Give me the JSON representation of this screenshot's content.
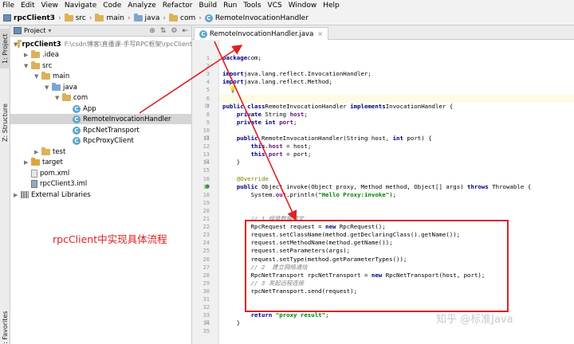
{
  "menu": [
    "File",
    "Edit",
    "View",
    "Navigate",
    "Code",
    "Analyze",
    "Refactor",
    "Build",
    "Run",
    "Tools",
    "VCS",
    "Window",
    "Help"
  ],
  "breadcrumb": [
    "rpcClient3",
    "src",
    "main",
    "java",
    "com",
    "RemoteInvocationHandler"
  ],
  "tool_tabs": {
    "project": "1: Project",
    "structure": "Z: Structure",
    "favorites": "2: Favorites"
  },
  "project_panel": {
    "title": "Project",
    "root_path": "F:\\csdn博客\\直播课-手写RPC框架\\rpcClient",
    "tree": [
      {
        "label": "rpcClient3",
        "kind": "project",
        "arrow": "▼",
        "indent": 0
      },
      {
        "label": ".idea",
        "kind": "folder",
        "arrow": "▶",
        "indent": 1
      },
      {
        "label": "src",
        "kind": "folder",
        "arrow": "▼",
        "indent": 1
      },
      {
        "label": "main",
        "kind": "folder",
        "arrow": "▼",
        "indent": 2
      },
      {
        "label": "java",
        "kind": "folder-blue",
        "arrow": "▼",
        "indent": 3
      },
      {
        "label": "com",
        "kind": "folder",
        "arrow": "▼",
        "indent": 4
      },
      {
        "label": "App",
        "kind": "class",
        "arrow": "",
        "indent": 5
      },
      {
        "label": "RemoteInvocationHandler",
        "kind": "class",
        "arrow": "",
        "indent": 5,
        "selected": true
      },
      {
        "label": "RpcNetTransport",
        "kind": "class",
        "arrow": "",
        "indent": 5
      },
      {
        "label": "RpcProxyClient",
        "kind": "class",
        "arrow": "",
        "indent": 5
      },
      {
        "label": "test",
        "kind": "folder",
        "arrow": "▶",
        "indent": 2
      },
      {
        "label": "target",
        "kind": "folder-orange",
        "arrow": "▶",
        "indent": 1
      },
      {
        "label": "pom.xml",
        "kind": "file",
        "arrow": "",
        "indent": 1
      },
      {
        "label": "rpcClient3.iml",
        "kind": "iml",
        "arrow": "",
        "indent": 1
      },
      {
        "label": "External Libraries",
        "kind": "lib",
        "arrow": "▶",
        "indent": 0
      }
    ]
  },
  "editor": {
    "tab_label": "RemoteInvocationHandler.java",
    "line_numbers": [
      "1",
      "2",
      "3",
      "4",
      "5",
      "6",
      "7",
      "8",
      "9",
      "10",
      "11",
      "12",
      "13",
      "14",
      "15",
      "16",
      "17",
      "18",
      "19",
      "20",
      "21",
      "22",
      "23",
      "24",
      "25",
      "26",
      "27",
      "28",
      "29",
      "30",
      "31",
      "32",
      "33",
      "34",
      "35"
    ],
    "lines": [
      [
        [
          "kw",
          "package"
        ],
        [
          "",
          "com;"
        ]
      ],
      [],
      [
        [
          "kw",
          "import"
        ],
        [
          "",
          "java.lang.reflect.InvocationHandler;"
        ]
      ],
      [
        [
          "kw",
          "import"
        ],
        [
          "",
          "java.lang.reflect.Method;"
        ]
      ],
      [],
      [],
      [
        [
          "kw",
          "public class"
        ],
        [
          "",
          "RemoteInvocationHandler "
        ],
        [
          "kw",
          "implements"
        ],
        [
          "",
          "InvocationHandler {"
        ]
      ],
      [
        [
          "",
          "    "
        ],
        [
          "kw",
          "private"
        ],
        [
          "",
          " String "
        ],
        [
          "fld",
          "host"
        ],
        [
          "",
          ";"
        ]
      ],
      [
        [
          "",
          "    "
        ],
        [
          "kw",
          "private int"
        ],
        [
          "",
          " "
        ],
        [
          "fld",
          "port"
        ],
        [
          "",
          ";"
        ]
      ],
      [],
      [
        [
          "",
          "    "
        ],
        [
          "kw",
          "public"
        ],
        [
          "",
          " RemoteInvocationHandler(String host, "
        ],
        [
          "kw",
          "int"
        ],
        [
          "",
          " port) {"
        ]
      ],
      [
        [
          "",
          "        "
        ],
        [
          "kw",
          "this"
        ],
        [
          "",
          "."
        ],
        [
          "fld",
          "host"
        ],
        [
          "",
          " = host;"
        ]
      ],
      [
        [
          "",
          "        "
        ],
        [
          "kw",
          "this"
        ],
        [
          "",
          "."
        ],
        [
          "fld",
          "port"
        ],
        [
          "",
          " = port;"
        ]
      ],
      [
        [
          "",
          "    }"
        ]
      ],
      [],
      [
        [
          "",
          "    "
        ],
        [
          "ann",
          "@Override"
        ]
      ],
      [
        [
          "",
          "    "
        ],
        [
          "kw",
          "public"
        ],
        [
          "",
          " Object invoke(Object proxy, Method method, Object[] args) "
        ],
        [
          "kw",
          "throws"
        ],
        [
          "",
          " Throwable {"
        ]
      ],
      [
        [
          "",
          "        System."
        ],
        [
          "fld",
          "out"
        ],
        [
          "",
          ".println("
        ],
        [
          "str",
          "\"Hello Proxy:invoke\""
        ],
        [
          "",
          ");"
        ]
      ],
      [],
      [],
      [
        [
          "",
          "        "
        ],
        [
          "cmt",
          "// 1 组装数据报文"
        ]
      ],
      [
        [
          "",
          "        RpcRequest request = "
        ],
        [
          "kw",
          "new"
        ],
        [
          "",
          " RpcRequest();"
        ]
      ],
      [
        [
          "",
          "        request.setClassName(method.getDeclaringClass().getName());"
        ]
      ],
      [
        [
          "",
          "        request.setMethodName(method.getName());"
        ]
      ],
      [
        [
          "",
          "        request.setParameters(args);"
        ]
      ],
      [
        [
          "",
          "        request.setType(method.getParameterTypes());"
        ]
      ],
      [
        [
          "",
          "        "
        ],
        [
          "cmt",
          "// 2  建立网络通信"
        ]
      ],
      [
        [
          "",
          "        RpcNetTransport rpcNetTransport = "
        ],
        [
          "kw",
          "new"
        ],
        [
          "",
          " RpcNetTransport(host, port);"
        ]
      ],
      [
        [
          "",
          "        "
        ],
        [
          "cmt",
          "// 3 发起远程连接"
        ]
      ],
      [
        [
          "",
          "        rpcNetTransport.send(request);"
        ]
      ],
      [],
      [],
      [
        [
          "",
          "        "
        ],
        [
          "kw",
          "return"
        ],
        [
          "",
          " "
        ],
        [
          "str",
          "\"proxy result\""
        ],
        [
          "",
          ";"
        ]
      ],
      [
        [
          "",
          "    }"
        ]
      ],
      []
    ]
  },
  "annotation": {
    "label": "rpcClient中实现具体流程",
    "color": "#dd2222"
  },
  "watermark": "知乎 @标准Java"
}
